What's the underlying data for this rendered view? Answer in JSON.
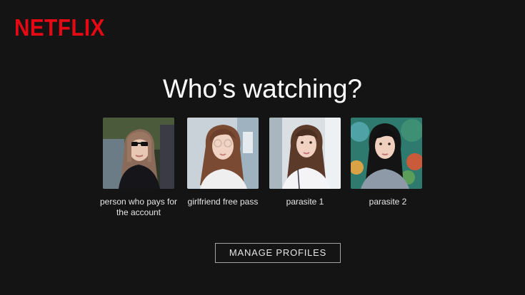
{
  "brand": {
    "logo_text": "NETFLIX",
    "logo_color": "#e50914"
  },
  "heading": "Who’s watching?",
  "profiles": [
    {
      "name": "person who pays for the account",
      "avatar": "woman-sunglasses-avatar"
    },
    {
      "name": "girlfriend free pass",
      "avatar": "woman-glasses-avatar"
    },
    {
      "name": "parasite 1",
      "avatar": "woman-white-top-avatar"
    },
    {
      "name": "parasite 2",
      "avatar": "woman-gray-top-avatar"
    }
  ],
  "manage_profiles_label": "MANAGE PROFILES",
  "colors": {
    "background": "#141414",
    "text": "#e5e5e5"
  }
}
